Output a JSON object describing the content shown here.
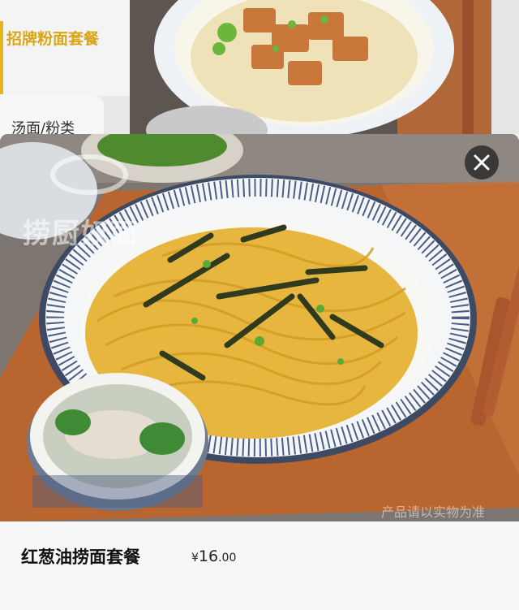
{
  "sidebar": {
    "active_category": "招牌粉面套餐",
    "second_category": "汤面/粉类"
  },
  "product": {
    "name": "红葱油捞面套餐",
    "price_symbol": "¥",
    "price_integer": "16",
    "price_decimal": ".00",
    "image_watermark_brand": "捞厨奴面",
    "image_disclaimer": "产品请以实物为准"
  },
  "icons": {
    "close": "close-icon"
  },
  "colors": {
    "accent": "#e3b41b",
    "close_button_bg": "#2b2b2b"
  }
}
